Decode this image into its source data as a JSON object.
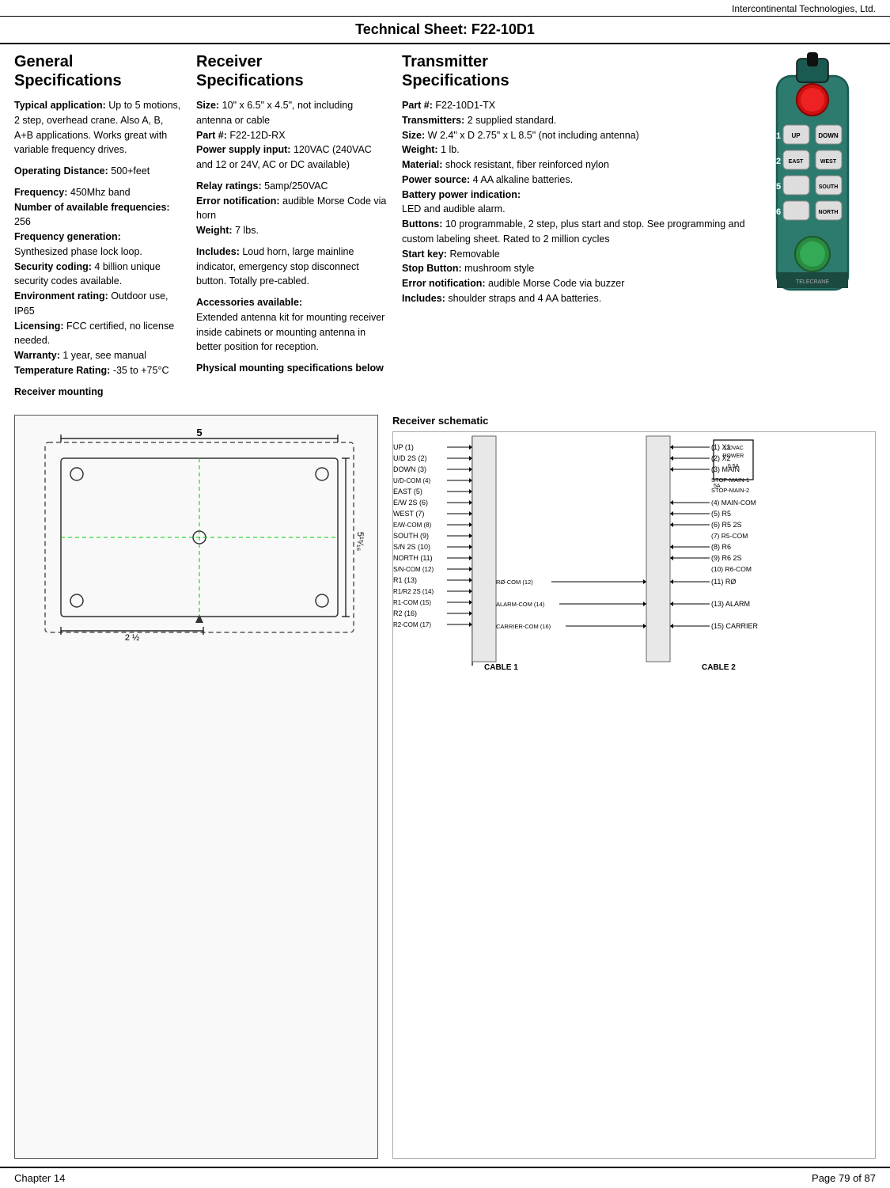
{
  "header": {
    "company": "Intercontinental Technologies, Ltd.",
    "title": "Technical Sheet:  F22-10D1"
  },
  "general": {
    "heading1": "General",
    "heading2": "Specifications",
    "typical_app_label": "Typical application:",
    "typical_app_text": "Up to 5 motions, 2 step, overhead crane.  Also A, B, A+B applications. Works great with variable frequency drives.",
    "operating_dist_label": "Operating Distance:",
    "operating_dist_text": "500+feet",
    "frequency_label": "Frequency:",
    "frequency_text": "450Mhz band",
    "num_freq_label": "Number of available frequencies:",
    "num_freq_text": "256",
    "freq_gen_label": "Frequency generation:",
    "freq_gen_text": "Synthesized phase lock loop.",
    "security_label": "Security coding:",
    "security_text": "4 billion unique security codes available.",
    "env_label": "Environment rating:",
    "env_text": "Outdoor use, IP65",
    "licensing_label": "Licensing:",
    "licensing_text": "FCC certified, no license needed.",
    "warranty_label": "Warranty:",
    "warranty_text": "1 year, see manual",
    "temp_label": "Temperature Rating:",
    "temp_text": "-35 to +75°C",
    "receiver_mounting_label": "Receiver mounting"
  },
  "receiver": {
    "heading1": "Receiver",
    "heading2": "Specifications",
    "size_label": "Size:",
    "size_text": "10\" x  6.5\" x  4.5\", not including antenna or cable",
    "part_label": "Part #:",
    "part_text": "F22-12D-RX",
    "power_label": "Power supply input:",
    "power_text": "120VAC (240VAC and 12 or 24V, AC or DC available)",
    "relay_label": "Relay ratings:",
    "relay_text": "5amp/250VAC",
    "error_label": "Error notification:",
    "error_text": "audible Morse Code via  horn",
    "weight_label": "Weight:",
    "weight_text": "7 lbs.",
    "includes_label": "Includes:",
    "includes_text": "Loud horn, large mainline indicator, emergency stop disconnect button. Totally pre-cabled.",
    "accessories_label": "Accessories available:",
    "accessories_text": "Extended antenna kit for mounting receiver inside cabinets or mounting antenna in better position for reception.",
    "physical_label": "Physical mounting specifications below"
  },
  "transmitter": {
    "heading1": "Transmitter",
    "heading2": "Specifications",
    "part_label": "Part #:",
    "part_text": "F22-10D1-TX",
    "transmitters_label": "Transmitters:",
    "transmitters_text": "2 supplied standard.",
    "size_label": "Size:",
    "size_text": "W 2.4\" x D 2.75\" x L 8.5\" (not including antenna)",
    "weight_label": "Weight:",
    "weight_text": "1 lb.",
    "material_label": "Material:",
    "material_text": "shock resistant, fiber reinforced nylon",
    "power_label": "Power source:",
    "power_text": "4 AA alkaline batteries.",
    "battery_label": "Battery power indication:",
    "battery_text": "LED and audible alarm.",
    "buttons_label": "Buttons:",
    "buttons_text": "10 programmable,  2 step, plus start and stop. See programming and custom labeling sheet. Rated to 2 million cycles",
    "start_label": "Start key:",
    "start_text": "Removable",
    "stop_label": "Stop Button:",
    "stop_text": "mushroom style",
    "error_label": "Error notification:",
    "error_text": "audible Morse Code via buzzer",
    "includes_label": "Includes:",
    "includes_text": "shoulder straps  and 4 AA batteries."
  },
  "bottom": {
    "mounting_title": "Receiver mounting",
    "schematic_title": "Receiver schematic",
    "dim1": "5",
    "dim2": "5¹⁵⁄₁₆",
    "dim3": "2 ½",
    "cable1": "CABLE 1",
    "cable2": "CABLE 2"
  },
  "schematic": {
    "left_labels": [
      "UP (1)",
      "U/D 2S (2)",
      "DOWN (3)",
      "U/D-COM (4)",
      "EAST (5)",
      "E/W 2S (6)",
      "E/W-COM (8)",
      "WEST (7)",
      "SOUTH (9)",
      "S/N 2S (10)",
      "S/N-COM (12)",
      "NORTH (11)",
      "R1 (13)",
      "R1/R2 2S (14)",
      "R1-COM (15)",
      "R2 (16)",
      "R2-COM (17)"
    ],
    "right_labels": [
      "(1) X1",
      "(2) X2",
      "(3) MAIN",
      "STOP-MAIN-1",
      "STOP-MAIN-2",
      "(4) MAIN-COM",
      "(5) R5",
      "(6) R5 2S",
      "(7) R5-COM",
      "(8) R6",
      "(9) R6 2S",
      "(10) R6-COM",
      "(11) RØ",
      "(13) ALARM",
      "(15) CARRIER"
    ],
    "power_labels": [
      "120VAC",
      "POWER",
      "0.5A",
      "5A"
    ],
    "rø_label": "RØ-COM (12)",
    "alarm_label": "ALARM-COM (14)",
    "carrier_label": "CARRIER-COM (16)"
  },
  "footer": {
    "left": "Chapter 14",
    "right": "Page 79 of 87"
  }
}
